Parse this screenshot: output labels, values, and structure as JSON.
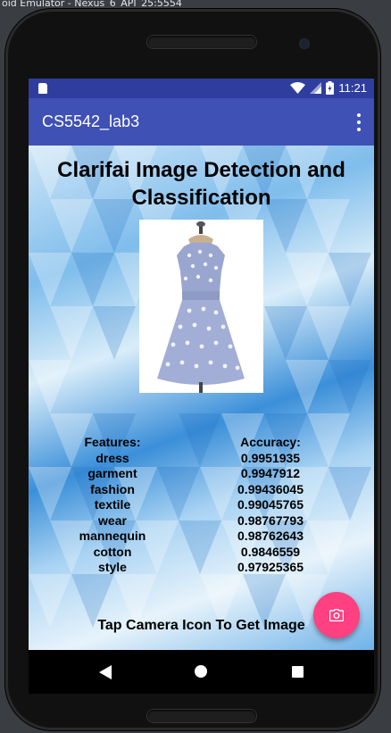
{
  "emulator": {
    "window_title": "oid Emulator - Nexus_6_API_25:5554"
  },
  "statusbar": {
    "time": "11:21",
    "icons": [
      "sd-card-icon",
      "wifi-icon",
      "cell-signal-icon",
      "battery-icon"
    ],
    "bg_color": "#2f3e9e"
  },
  "appbar": {
    "title": "CS5542_lab3",
    "menu_icon": "overflow-menu-icon",
    "bg_color": "#3f51b5"
  },
  "main": {
    "heading": "Clarifai Image Detection and Classification",
    "image_alt": "dress-photo",
    "features_header": "Features:",
    "accuracy_header": "Accuracy:",
    "results": [
      {
        "feature": "dress",
        "accuracy": "0.9951935"
      },
      {
        "feature": "garment",
        "accuracy": "0.9947912"
      },
      {
        "feature": "fashion",
        "accuracy": "0.99436045"
      },
      {
        "feature": "textile",
        "accuracy": "0.99045765"
      },
      {
        "feature": "wear",
        "accuracy": "0.98767793"
      },
      {
        "feature": "mannequin",
        "accuracy": "0.98762643"
      },
      {
        "feature": "cotton",
        "accuracy": "0.9846559"
      },
      {
        "feature": "style",
        "accuracy": "0.97925365"
      }
    ],
    "instruction": "Tap Camera Icon To Get Image"
  },
  "fab": {
    "icon": "camera-icon",
    "color": "#ff4081"
  },
  "navbar": {
    "icons": [
      "back-icon",
      "home-icon",
      "recents-icon"
    ]
  }
}
